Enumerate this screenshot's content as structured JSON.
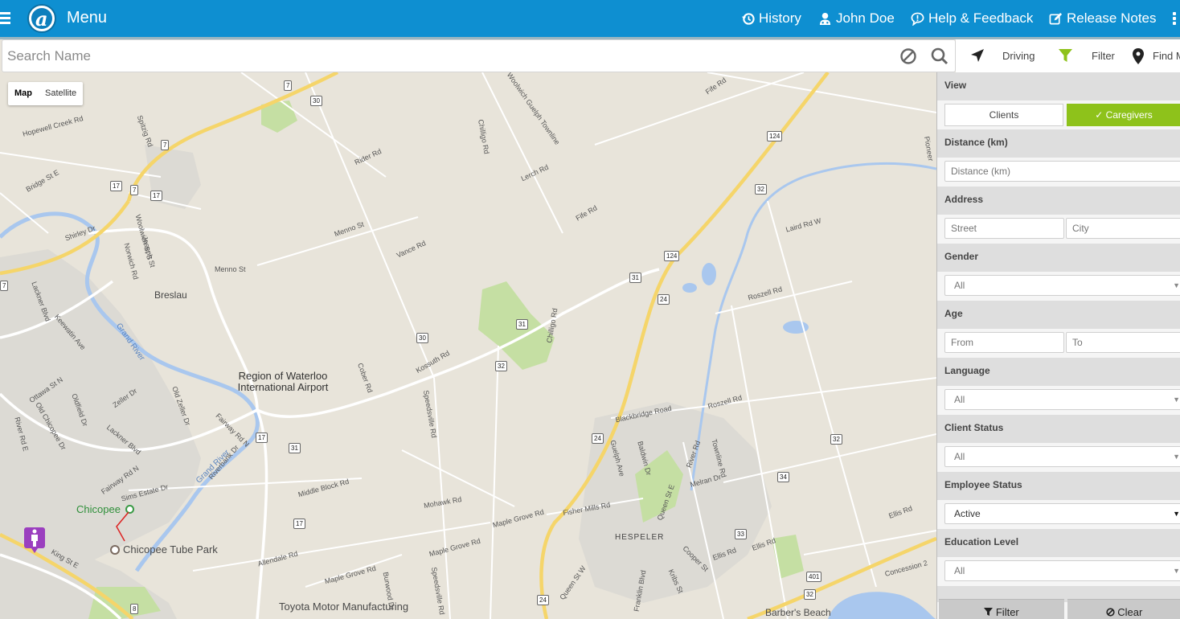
{
  "header": {
    "menu_label": "Menu",
    "history_label": "History",
    "user_label": "John Doe",
    "help_label": "Help & Feedback",
    "release_label": "Release Notes",
    "brand_color": "#0e8fd1"
  },
  "search": {
    "placeholder": "Search Name"
  },
  "toolbar": {
    "driving_label": "Driving",
    "filter_label": "Filter",
    "find_label": "Find M"
  },
  "map": {
    "type_map": "Map",
    "type_satellite": "Satellite",
    "roads": [
      "Hopewell Creek Rd",
      "Spitzig Rd",
      "Bridge St E",
      "Woolwich St S",
      "Joseph St",
      "Norwich Rd",
      "Shirley Dr",
      "Menno St",
      "Menno St",
      "Rider Rd",
      "Vance Rd",
      "Woolwich Guelph Townline",
      "Chilligo Rd",
      "Lerch Rd",
      "Fife Rd",
      "Fife Rd",
      "Kossuth Rd",
      "Speedsville Rd",
      "Chilligo Rd",
      "Cober Rd",
      "Fairway Rd N",
      "Riverbank Dr",
      "Middle Block Rd",
      "Mohawk Rd",
      "Maple Grove Rd",
      "Maple Grove Rd",
      "Allendale Rd",
      "Maple Grove Rd",
      "Burwood Dr",
      "Speedsville Rd",
      "Fisher Mills Rd",
      "Blackbridge Road",
      "Roszell Rd",
      "Roszell Rd",
      "Laird Rd W",
      "Guelph Ave",
      "Baldwin Dr",
      "River Rd",
      "Townline Rd",
      "Queen St E",
      "Melran Dr",
      "Ellis Rd",
      "Ellis Rd",
      "Ellis Rd",
      "Cooper St",
      "Queen St W",
      "Franklin Blvd",
      "Kribs St",
      "Concession 2",
      "Lackner Blvd",
      "Keewatin Ave",
      "Ottawa St N",
      "Oldfield Dr",
      "Zeller Dr",
      "Old Zeller Dr",
      "Old Chicopee Dr",
      "River Rd E",
      "Lackner Blvd",
      "Fairway Rd N",
      "Sims Estate Dr",
      "King St E",
      "Pioneer"
    ],
    "shields": [
      "7",
      "30",
      "7",
      "17",
      "7",
      "17",
      "124",
      "32",
      "124",
      "31",
      "24",
      "31",
      "30",
      "32",
      "17",
      "31",
      "24",
      "32",
      "34",
      "33",
      "401",
      "32",
      "17",
      "8",
      "24",
      "7"
    ],
    "places": {
      "breslau": "Breslau",
      "airport": "Region of Waterloo International Airport",
      "hespeler": "HESPELER",
      "chicopee": "Chicopee",
      "tube_park": "Chicopee Tube Park",
      "toyota": "Toyota Motor Manufacturing",
      "barbers_beach": "Barber's Beach",
      "grand_river": "Grand River"
    }
  },
  "filter_panel": {
    "view_title": "View",
    "view_clients": "Clients",
    "view_caregivers": "✓ Caregivers",
    "distance_title": "Distance (km)",
    "distance_placeholder": "Distance (km)",
    "address_title": "Address",
    "street_placeholder": "Street",
    "city_placeholder": "City",
    "gender_title": "Gender",
    "gender_value": "All",
    "age_title": "Age",
    "age_from_placeholder": "From",
    "age_to_placeholder": "To",
    "language_title": "Language",
    "language_value": "All",
    "client_status_title": "Client Status",
    "client_status_value": "All",
    "employee_status_title": "Employee Status",
    "employee_status_value": "Active",
    "education_title": "Education Level",
    "education_value": "All",
    "filter_button": "Filter",
    "clear_button": "Clear",
    "accent_color": "#8ec21b"
  }
}
